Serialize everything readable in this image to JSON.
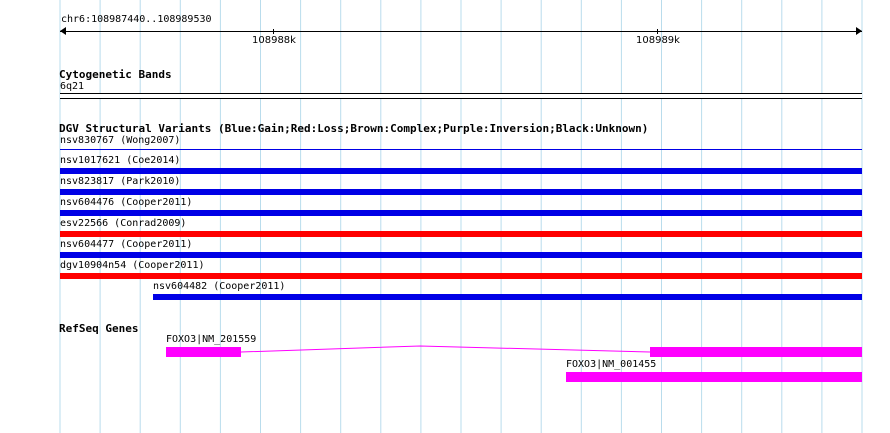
{
  "location": "chr6:108987440..108989530",
  "ruler": {
    "ticks": [
      {
        "label": "108988k"
      },
      {
        "label": "108989k"
      }
    ]
  },
  "cytoband": {
    "title": "Cytogenetic Bands",
    "band": "6q21"
  },
  "dgv": {
    "title": "DGV Structural Variants (Blue:Gain;Red:Loss;Brown:Complex;Purple:Inversion;Black:Unknown)",
    "variants": [
      {
        "label": "nsv830767 (Wong2007)",
        "color": "#0000e6",
        "thin": true
      },
      {
        "label": "nsv1017621 (Coe2014)",
        "color": "#0000e6"
      },
      {
        "label": "nsv823817 (Park2010)",
        "color": "#0000e6"
      },
      {
        "label": "nsv604476 (Cooper2011)",
        "color": "#0000e6"
      },
      {
        "label": "esv22566 (Conrad2009)",
        "color": "#ff0000"
      },
      {
        "label": "nsv604477 (Cooper2011)",
        "color": "#0000e6"
      },
      {
        "label": "dgv10904n54 (Cooper2011)",
        "color": "#ff0000"
      },
      {
        "label": "nsv604482 (Cooper2011)",
        "color": "#0000e6"
      }
    ]
  },
  "refseq": {
    "title": "RefSeq Genes",
    "color": "#ff00ff",
    "genes": [
      {
        "label": "FOXO3|NM_201559"
      },
      {
        "label": "FOXO3|NM_001455"
      }
    ]
  }
}
